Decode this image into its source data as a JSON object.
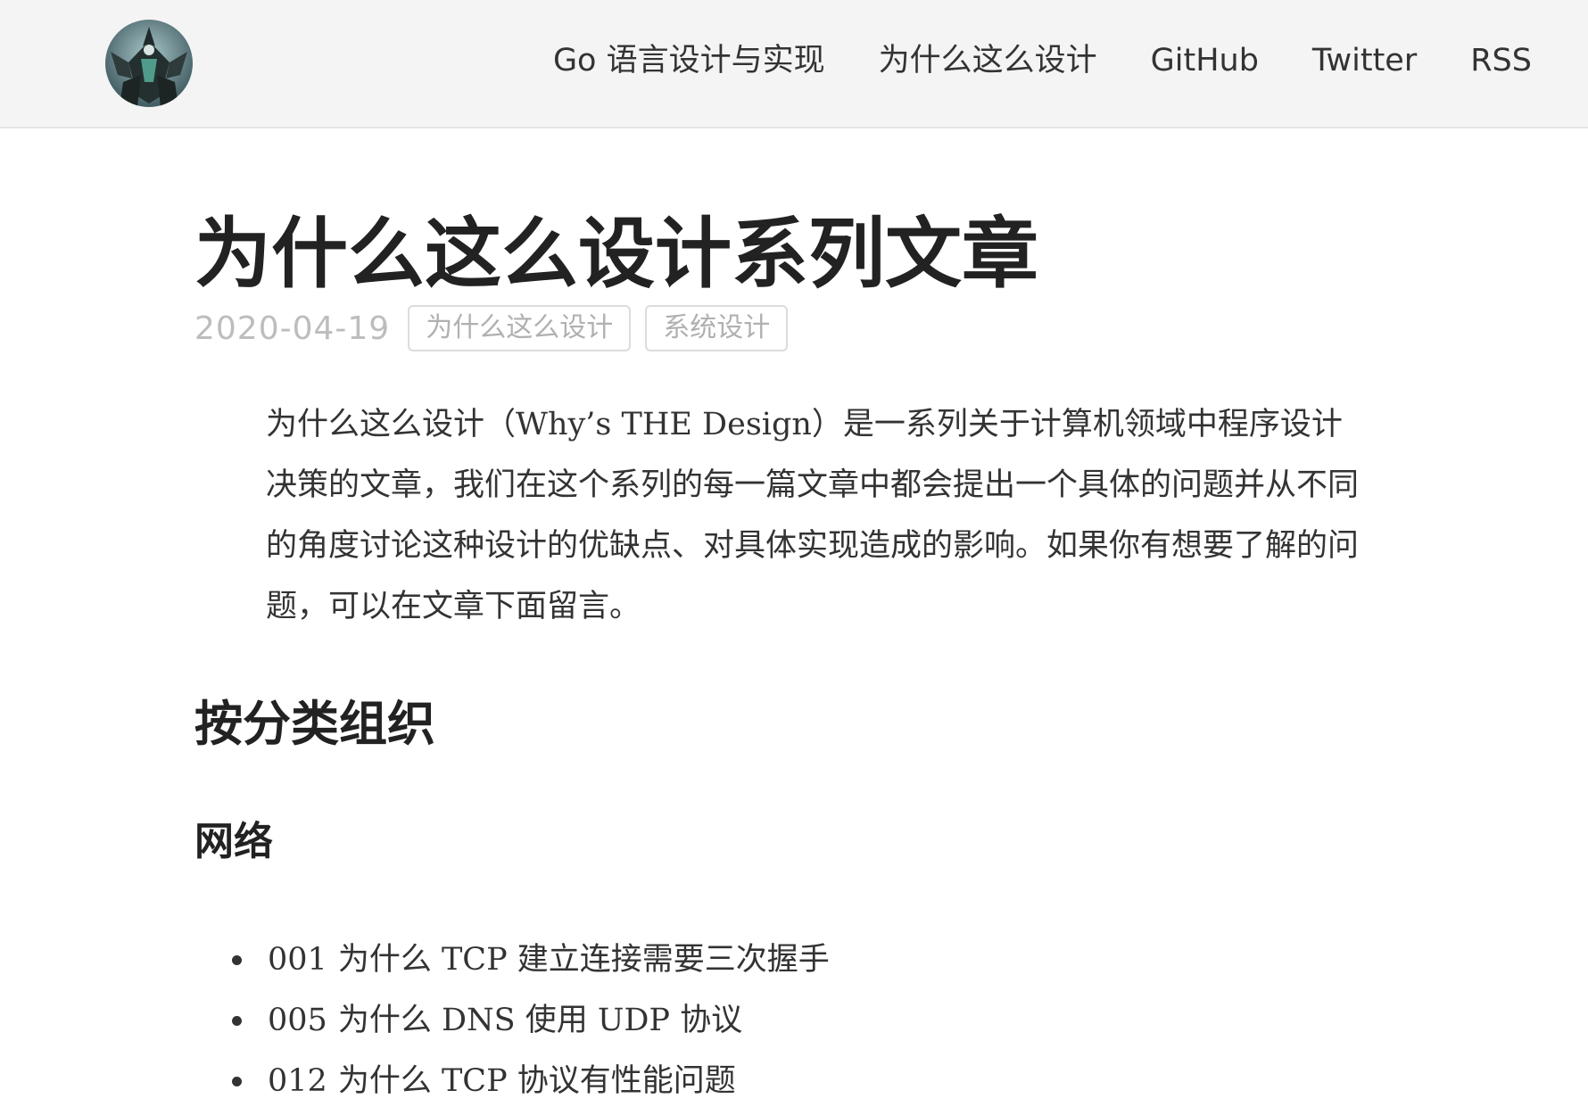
{
  "header": {
    "nav": [
      "Go 语言设计与实现",
      "为什么这么设计",
      "GitHub",
      "Twitter",
      "RSS"
    ]
  },
  "post": {
    "title": "为什么这么设计系列文章",
    "date": "2020-04-19",
    "tags": [
      "为什么这么设计",
      "系统设计"
    ],
    "intro": "为什么这么设计（Why’s THE Design）是一系列关于计算机领域中程序设计决策的文章，我们在这个系列的每一篇文章中都会提出一个具体的问题并从不同的角度讨论这种设计的优缺点、对具体实现造成的影响。如果你有想要了解的问题，可以在文章下面留言。",
    "section_heading": "按分类组织",
    "categories": [
      {
        "name": "网络",
        "articles": [
          {
            "number": "001",
            "title": "为什么 TCP 建立连接需要三次握手"
          },
          {
            "number": "005",
            "title": "为什么 DNS 使用 UDP 协议"
          },
          {
            "number": "012",
            "title": "为什么 TCP 协议有性能问题"
          }
        ]
      }
    ]
  },
  "colors": {
    "header_bg": "#f4f4f4",
    "link_highlight": "#c8f1dc",
    "muted": "#bdbdbd",
    "text": "#222222"
  }
}
